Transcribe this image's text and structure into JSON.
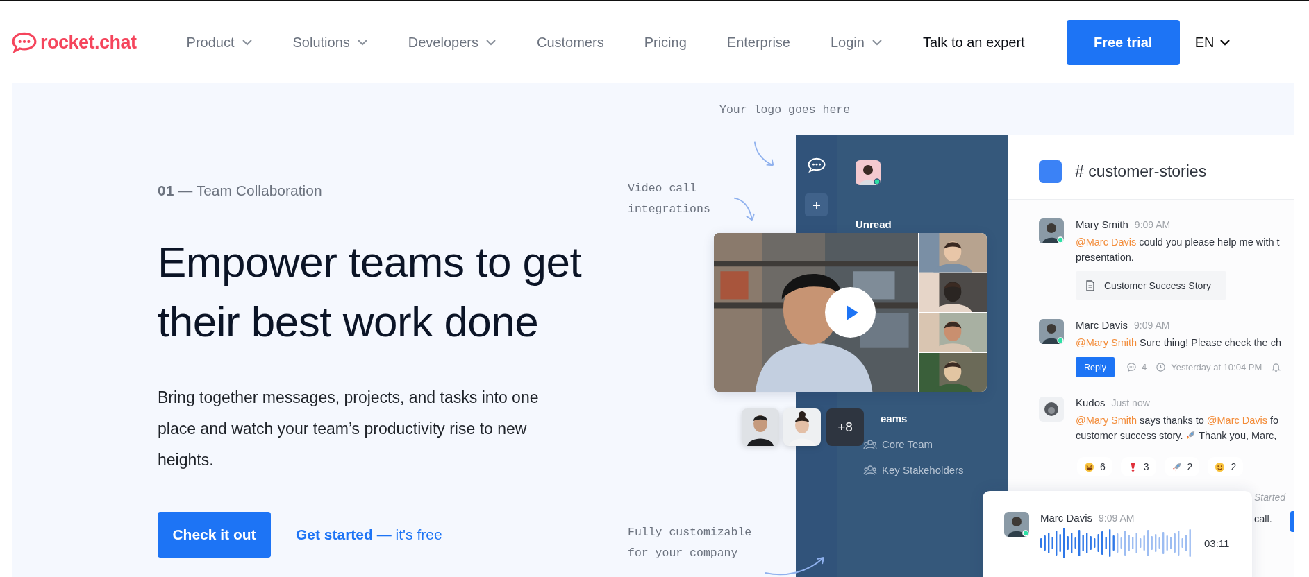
{
  "nav": {
    "logo": "rocket.chat",
    "items": [
      {
        "label": "Product",
        "dropdown": true
      },
      {
        "label": "Solutions",
        "dropdown": true
      },
      {
        "label": "Developers",
        "dropdown": true
      },
      {
        "label": "Customers",
        "dropdown": false
      },
      {
        "label": "Pricing",
        "dropdown": false
      },
      {
        "label": "Enterprise",
        "dropdown": false
      },
      {
        "label": "Login",
        "dropdown": true
      }
    ],
    "expert_link": "Talk to an expert",
    "trial_button": "Free trial",
    "language": "EN"
  },
  "hero": {
    "eyebrow": "**01** — Team Collaboration",
    "heading": "Empower teams to get their best work done",
    "description": "Bring together messages, projects, and tasks into one place and watch your team’s productivity rise to new heights.",
    "primary_button": "Check it out",
    "secondary_link": "**Get started** — it's free"
  },
  "mockup": {
    "notes": [
      "Your logo goes here",
      "Video call integrations",
      "Fully customizable for your company"
    ],
    "sidebar": {
      "section": "Unread",
      "teams_label": "eams",
      "teams": [
        {
          "name": "Core Team"
        },
        {
          "name": "Key Stakeholders"
        }
      ]
    },
    "participants_more": "+8",
    "channel": "# customer-stories",
    "messages": [
      {
        "author": "Mary Smith",
        "time": "9:09 AM",
        "online": true,
        "lines": [
          [
            {
              "kind": "mention",
              "text": "@Marc Davis"
            },
            {
              "kind": "plain",
              "text": " could you please help me with t"
            }
          ],
          [
            {
              "kind": "plain",
              "text": "presentation."
            }
          ]
        ],
        "attachment": "Customer Success Story"
      },
      {
        "author": "Marc Davis",
        "time": "9:09 AM",
        "online": true,
        "lines": [
          [
            {
              "kind": "mention",
              "text": "@Mary Smith"
            },
            {
              "kind": "plain",
              "text": " Sure thing! Please check the ch"
            }
          ]
        ],
        "actions": {
          "reply": "Reply",
          "replies": "4",
          "last_reply": "Yesterday at 10:04 PM"
        }
      },
      {
        "author": "Kudos",
        "time": "Just now",
        "online": false,
        "lines": [
          [
            {
              "kind": "mention",
              "text": "@Mary Smith"
            },
            {
              "kind": "plain",
              "text": " says thanks to "
            },
            {
              "kind": "mention",
              "text": "@Marc Davis"
            },
            {
              "kind": "plain",
              "text": " fo"
            }
          ],
          [
            {
              "kind": "plain",
              "text": "customer success story. "
            },
            {
              "kind": "rocket"
            },
            {
              "kind": "plain",
              "text": " Thank you, Marc,"
            }
          ]
        ],
        "reactions": [
          {
            "kind": "laugh",
            "count": "6"
          },
          {
            "kind": "exclaim",
            "count": "3"
          },
          {
            "kind": "rocket",
            "count": "2"
          },
          {
            "kind": "smile",
            "count": "2"
          }
        ]
      }
    ],
    "behind_card": {
      "system_text": "Started",
      "text": "call."
    },
    "voice_message": {
      "author": "Marc Davis",
      "time": "9:09 AM",
      "online": true,
      "duration": "03:11"
    }
  }
}
